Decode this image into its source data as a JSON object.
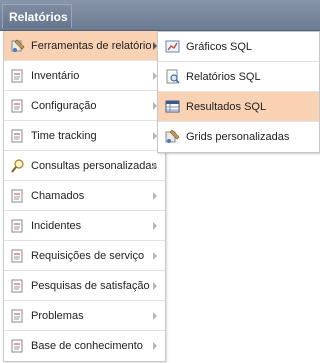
{
  "header": {
    "tab_label": "Relatórios"
  },
  "menu": {
    "items": [
      {
        "label": "Ferramentas de relatório",
        "icon": "tools-icon",
        "active": true
      },
      {
        "label": "Inventário",
        "icon": "document-icon"
      },
      {
        "label": "Configuração",
        "icon": "document-icon"
      },
      {
        "label": "Time tracking",
        "icon": "document-icon"
      },
      {
        "label": "Consultas personalizadas",
        "icon": "magnifier-icon"
      },
      {
        "label": "Chamados",
        "icon": "document-icon"
      },
      {
        "label": "Incidentes",
        "icon": "document-icon"
      },
      {
        "label": "Requisições de serviço",
        "icon": "document-icon"
      },
      {
        "label": "Pesquisas de satisfação",
        "icon": "document-icon"
      },
      {
        "label": "Problemas",
        "icon": "document-icon"
      },
      {
        "label": "Base de conhecimento",
        "icon": "document-icon"
      }
    ]
  },
  "submenu": {
    "items": [
      {
        "label": "Gráficos SQL",
        "icon": "chart-icon"
      },
      {
        "label": "Relatórios SQL",
        "icon": "report-icon"
      },
      {
        "label": "Resultados SQL",
        "icon": "table-icon",
        "active": true
      },
      {
        "label": "Grids personalizadas",
        "icon": "tools-icon"
      }
    ]
  },
  "colors": {
    "active_bg": "#f8d2b3",
    "header_bg": "#6b7b92"
  }
}
